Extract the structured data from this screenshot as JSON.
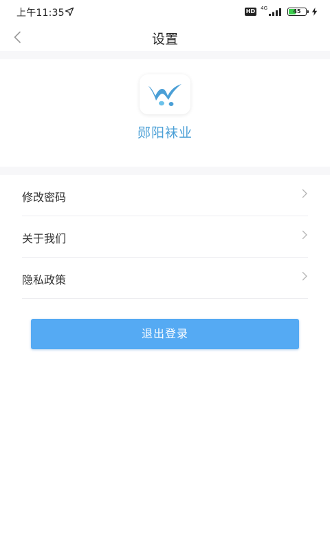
{
  "status_bar": {
    "time": "上午11:35",
    "hd_label": "HD",
    "network": "4G",
    "battery_level": "45",
    "battery_fraction": 0.45
  },
  "nav": {
    "title": "设置",
    "back_icon": "chevron-left-icon"
  },
  "brand": {
    "name": "郧阳袜业",
    "logo_icon": "brand-logo-icon",
    "logo_colors": [
      "#4a9fd6",
      "#6cc2ea"
    ]
  },
  "menu": {
    "items": [
      {
        "label": "修改密码",
        "icon": "chevron-right-icon"
      },
      {
        "label": "关于我们",
        "icon": "chevron-right-icon"
      },
      {
        "label": "隐私政策",
        "icon": "chevron-right-icon"
      }
    ]
  },
  "logout": {
    "label": "退出登录"
  },
  "colors": {
    "accent": "#55aaf3",
    "brand_text": "#4a9fd6",
    "divider": "#ececf0",
    "background_gap": "#f7f7f9"
  }
}
